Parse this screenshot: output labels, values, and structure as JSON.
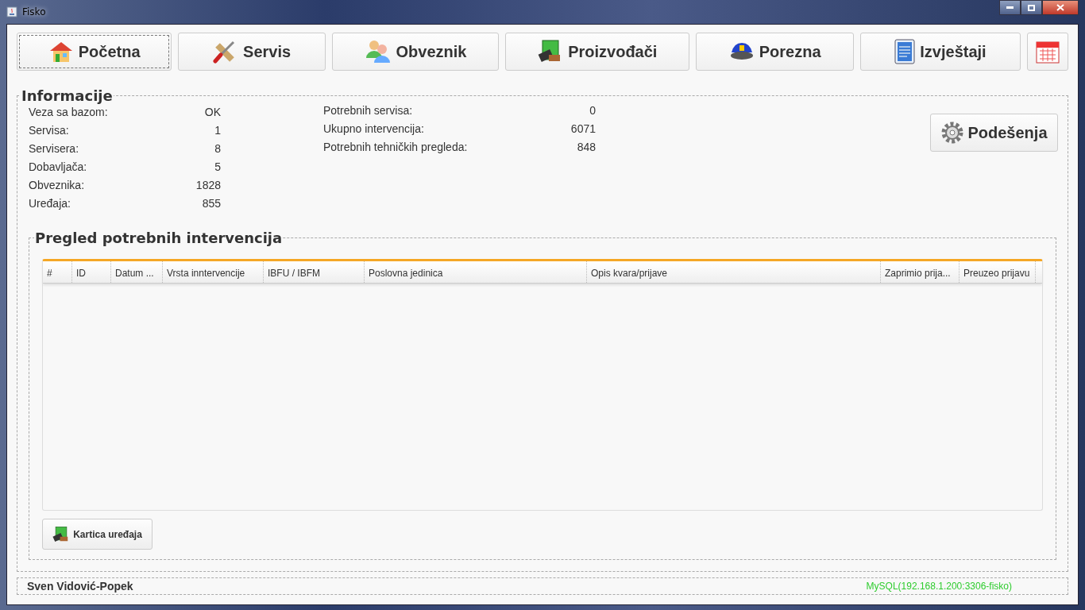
{
  "window": {
    "title": "Fisko"
  },
  "nav": [
    {
      "label": "Početna",
      "kind": "house",
      "selected": true
    },
    {
      "label": "Servis",
      "kind": "tools",
      "selected": false
    },
    {
      "label": "Obveznik",
      "kind": "people",
      "selected": false
    },
    {
      "label": "Proizvođači",
      "kind": "board",
      "selected": false
    },
    {
      "label": "Porezna",
      "kind": "cap",
      "selected": false
    },
    {
      "label": "Izvještaji",
      "kind": "report",
      "selected": false
    },
    {
      "kind": "calendar",
      "selected": false
    }
  ],
  "info": {
    "title": "Informacije",
    "left": [
      {
        "label": "Veza sa bazom:",
        "value": "OK"
      },
      {
        "label": "Servisa:",
        "value": "1"
      },
      {
        "label": "Servisera:",
        "value": "8"
      },
      {
        "label": "Dobavljača:",
        "value": "5"
      },
      {
        "label": "Obveznika:",
        "value": "1828"
      },
      {
        "label": "Uređaja:",
        "value": "855"
      }
    ],
    "right": [
      {
        "label": "Potrebnih servisa:",
        "value": "0"
      },
      {
        "label": "Ukupno intervencija:",
        "value": "6071"
      },
      {
        "label": "Potrebnih tehničkih pregleda:",
        "value": "848"
      }
    ],
    "settings_button": "Podešenja"
  },
  "interventions": {
    "title": "Pregled potrebnih intervencija",
    "columns": [
      "#",
      "ID",
      "Datum ...",
      "Vrsta inntervencije",
      "IBFU / IBFM",
      "Poslovna jedinica",
      "Opis kvara/prijave",
      "Zaprimio prija...",
      "Preuzeo prijavu"
    ],
    "button": "Kartica uređaja"
  },
  "status_bar": {
    "user": "Sven Vidović-Popek",
    "connection": "MySQL(192.168.1.200:3306-fisko)"
  }
}
